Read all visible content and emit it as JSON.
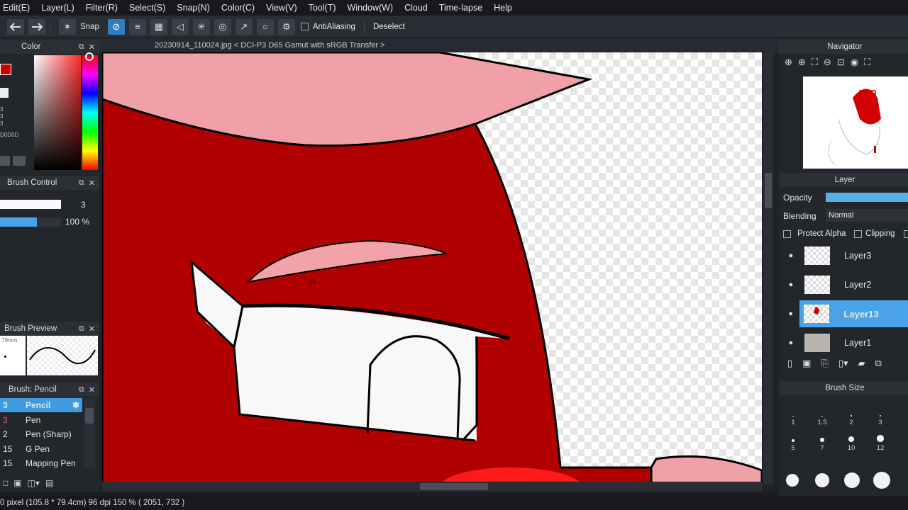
{
  "menu": [
    "Edit(E)",
    "Layer(L)",
    "Filter(R)",
    "Select(S)",
    "Snap(N)",
    "Color(C)",
    "View(V)",
    "Tool(T)",
    "Window(W)",
    "Cloud",
    "Time-lapse",
    "Help"
  ],
  "toolbar": {
    "snap_label": "Snap",
    "antialiasing_label": "AntiAliasing",
    "deselect_label": "Deselect"
  },
  "color_panel": {
    "title": "Color",
    "values": [
      "3",
      "3",
      "3",
      "D0D0D"
    ]
  },
  "brush_control": {
    "title": "Brush Control",
    "size": "3",
    "opacity": "100 %",
    "opacity_fraction": 0.6
  },
  "brush_preview": {
    "title": "Brush Preview",
    "size_text": "79mm"
  },
  "brush_list": {
    "title": "Brush: Pencil",
    "items": [
      {
        "num": "3",
        "name": "Pencil",
        "selected": true
      },
      {
        "num": "3",
        "name": "Pen",
        "selected": false
      },
      {
        "num": "2",
        "name": "Pen (Sharp)",
        "selected": false
      },
      {
        "num": "15",
        "name": "G Pen",
        "selected": false
      },
      {
        "num": "15",
        "name": "Mapping Pen",
        "selected": false
      }
    ]
  },
  "canvas": {
    "title": "20230914_110024.jpg < DCI-P3 D65 Gamut with sRGB Transfer >"
  },
  "navigator": {
    "title": "Navigator"
  },
  "layer_panel": {
    "title": "Layer",
    "opacity_label": "Opacity",
    "blending_label": "Blending",
    "blending_value": "Normal",
    "protect_alpha_label": "Protect Alpha",
    "clipping_label": "Clipping",
    "layers": [
      {
        "name": "Layer3",
        "selected": false
      },
      {
        "name": "Layer2",
        "selected": false
      },
      {
        "name": "Layer13",
        "selected": true
      },
      {
        "name": "Layer1",
        "selected": false
      }
    ]
  },
  "brush_size": {
    "title": "Brush Size",
    "sizes": [
      "1",
      "1.5",
      "2",
      "3",
      "5",
      "7",
      "10",
      "12"
    ]
  },
  "status": {
    "text": "0 pixel  (105.8 * 79.4cm)   96 dpi   150 %   ( 2051, 732 )"
  },
  "colors": {
    "accent": "#3d9be0",
    "red": "#b30000",
    "pink": "#f2a0a8"
  }
}
